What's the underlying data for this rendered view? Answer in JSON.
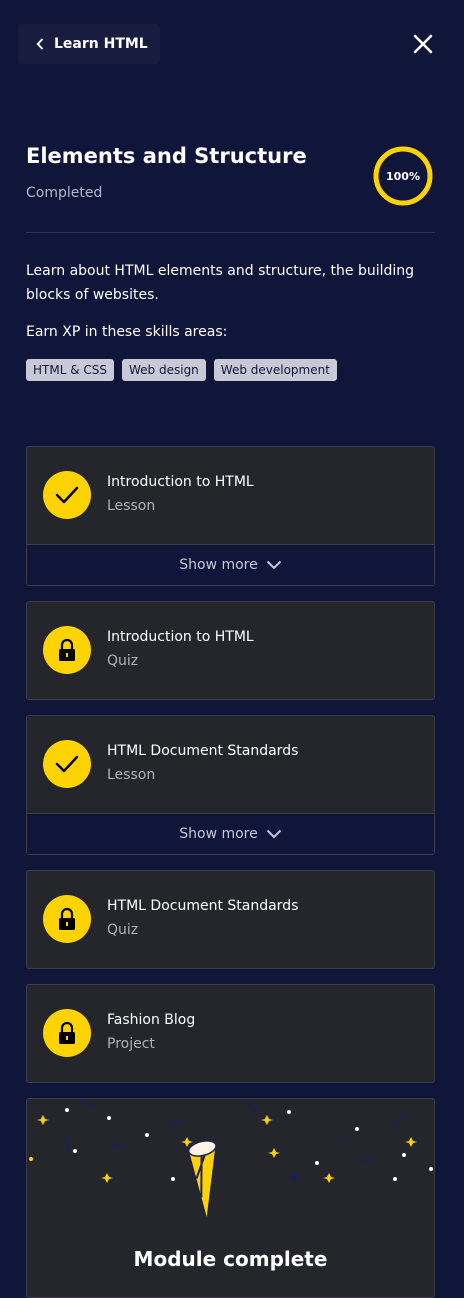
{
  "header": {
    "back_label": "Learn HTML"
  },
  "module": {
    "title": "Elements and Structure",
    "status": "Completed",
    "progress": "100%",
    "progress_fraction": 1.0,
    "description": "Learn about HTML elements and structure, the building blocks of websites.",
    "skills_label": "Earn XP in these skills areas:",
    "skills": [
      "HTML & CSS",
      "Web design",
      "Web development"
    ]
  },
  "items": [
    {
      "title": "Introduction to HTML",
      "type": "Lesson",
      "status": "check-icon",
      "show_more": "Show more"
    },
    {
      "title": "Introduction to HTML",
      "type": "Quiz",
      "status": "lock-icon"
    },
    {
      "title": "HTML Document Standards",
      "type": "Lesson",
      "status": "check-icon",
      "show_more": "Show more"
    },
    {
      "title": "HTML Document Standards",
      "type": "Quiz",
      "status": "lock-icon"
    },
    {
      "title": "Fashion Blog",
      "type": "Project",
      "status": "lock-icon"
    }
  ],
  "completion": {
    "title": "Module complete"
  },
  "colors": {
    "background": "#10153a",
    "accent": "#ffd300",
    "card": "#25262c"
  }
}
